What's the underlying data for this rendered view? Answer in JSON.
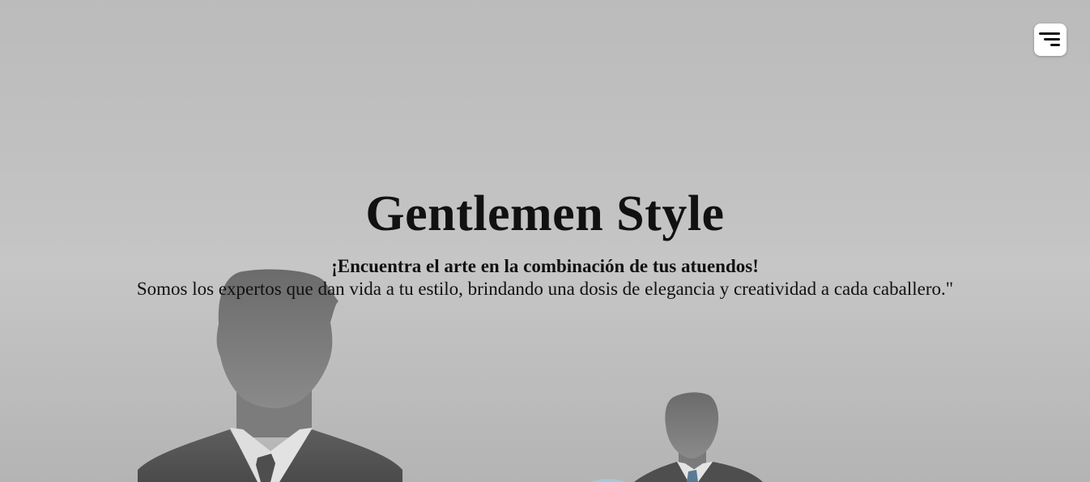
{
  "hero": {
    "title": "Gentlemen Style",
    "subtitle": "¡Encuentra el arte en la combinación de tus atuendos!",
    "description": "Somos los expertos que dan vida a tu estilo, brindando una dosis de elegancia y creatividad a cada caballero.\""
  },
  "nav": {
    "menu_icon": "hamburger-menu-icon"
  },
  "colors": {
    "background": "#c3c3c3",
    "text": "#111111",
    "silhouette": "#6e6e6e",
    "menu_button_bg": "#ffffff"
  }
}
